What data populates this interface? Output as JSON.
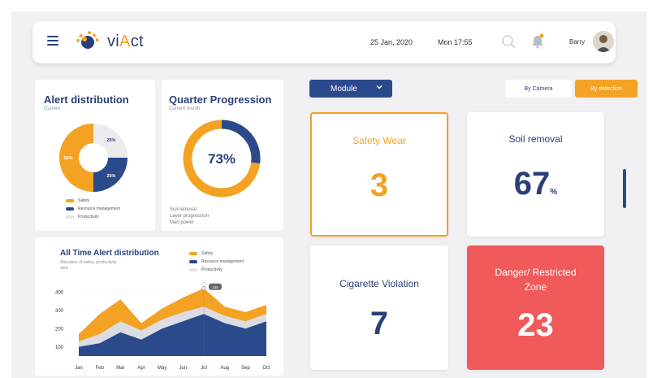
{
  "header": {
    "brand_pre": "vi",
    "brand_a": "A",
    "brand_post": "ct",
    "date": "25 Jan, 2020",
    "time": "Mon  17:55",
    "user": "Barry"
  },
  "alert_distribution": {
    "title": "Alert distribution",
    "subtitle": "Current",
    "slices": [
      {
        "name": "Safety",
        "label": "50%",
        "percent": 50,
        "color": "#f4a224"
      },
      {
        "name": "Resource management",
        "label": "25%",
        "percent": 25,
        "color": "#2a4a8c"
      },
      {
        "name": "Productivity",
        "label": "25%",
        "percent": 25,
        "color": "#ececef"
      }
    ]
  },
  "quarter_progression": {
    "title": "Quarter Progression",
    "subtitle": "Current month",
    "value_label": "73%",
    "value": 73,
    "items": [
      "Soil removal",
      "Layer progression",
      "Man power"
    ]
  },
  "all_time": {
    "title": "All Time Alert distribution",
    "subtitle_line1": "Allocation of safety, productivity",
    "subtitle_line2": "alert",
    "tooltip": "145"
  },
  "chart_data": {
    "type": "area",
    "title": "All Time Alert distribution",
    "categories": [
      "Jan",
      "Feb",
      "Mar",
      "Apr",
      "May",
      "Jun",
      "Jul",
      "Aug",
      "Sep",
      "Oct"
    ],
    "yticks": [
      100,
      200,
      300,
      400
    ],
    "ylim": [
      50,
      450
    ],
    "series": [
      {
        "name": "Safety",
        "color": "#f4a224",
        "values": [
          170,
          280,
          360,
          230,
          310,
          370,
          420,
          320,
          290,
          330
        ]
      },
      {
        "name": "Resource management",
        "color": "#2a4a8c",
        "values": [
          100,
          120,
          180,
          140,
          200,
          240,
          280,
          230,
          200,
          240
        ]
      },
      {
        "name": "Productivity",
        "color": "#dcdce3",
        "values": [
          130,
          170,
          240,
          190,
          250,
          290,
          320,
          270,
          240,
          280
        ]
      }
    ]
  },
  "controls": {
    "module_label": "Module",
    "by_camera": "By Camera",
    "by_detection": "By detection"
  },
  "stats": [
    {
      "label": "Safety Wear",
      "value": "3",
      "unit": ""
    },
    {
      "label": "Soil removal",
      "value": "67",
      "unit": "%"
    },
    {
      "label": "Cigarette Violation",
      "value": "7",
      "unit": ""
    },
    {
      "label_line1": "Danger/ Restricted",
      "label_line2": "Zone",
      "value": "23",
      "unit": ""
    }
  ],
  "colors": {
    "navy": "#2a4a8c",
    "orange": "#f4a224",
    "red": "#f05a5a"
  }
}
